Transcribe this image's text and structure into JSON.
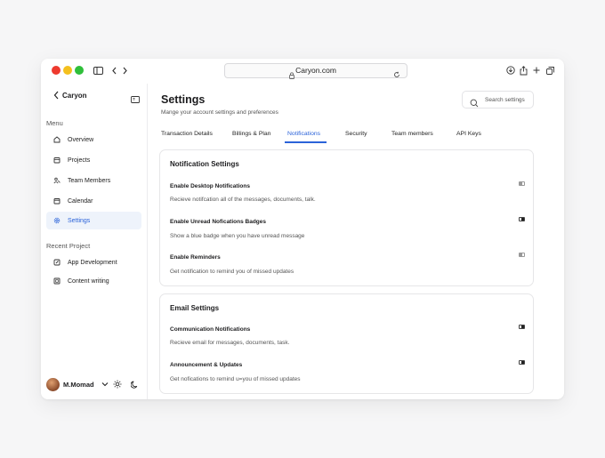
{
  "browser": {
    "url": "Caryon.com"
  },
  "sidebar": {
    "brand": "Caryon",
    "menu_label": "Menu",
    "items": [
      {
        "label": "Overview",
        "icon": "home-icon",
        "active": false
      },
      {
        "label": "Projects",
        "icon": "projects-icon",
        "active": false
      },
      {
        "label": "Team Members",
        "icon": "team-icon",
        "active": false
      },
      {
        "label": "Calendar",
        "icon": "calendar-icon",
        "active": false
      },
      {
        "label": "Settings",
        "icon": "gear-icon",
        "active": true
      }
    ],
    "recent_label": "Recent Project",
    "recent": [
      {
        "label": "App Development",
        "icon": "edit-icon"
      },
      {
        "label": "Content writing",
        "icon": "document-icon"
      }
    ],
    "user": {
      "name": "M.Momad"
    }
  },
  "header": {
    "title": "Settings",
    "subtitle": "Mange your account settings and preferences",
    "search_placeholder": "Search settings"
  },
  "tabs": [
    {
      "label": "Transaction Details",
      "active": false
    },
    {
      "label": "Billings & Plan",
      "active": false
    },
    {
      "label": "Notifications",
      "active": true
    },
    {
      "label": "Security",
      "active": false
    },
    {
      "label": "Team members",
      "active": false
    },
    {
      "label": "API Keys",
      "active": false
    }
  ],
  "notification_settings": {
    "title": "Notification Settings",
    "items": [
      {
        "title": "Enable Desktop Notifications",
        "desc": "Recieve notifcation all of the messages, documents, talk.",
        "enabled": false
      },
      {
        "title": "Enable Unread Nofications Badges",
        "desc": "Show a blue badge when you have unread message",
        "enabled": true
      },
      {
        "title": "Enable Reminders",
        "desc": "Get notification to remind you of missed updates",
        "enabled": false
      }
    ]
  },
  "email_settings": {
    "title": "Email Settings",
    "items": [
      {
        "title": "Communication Notifications",
        "desc": "Recieve email for messages, documents, task.",
        "enabled": true
      },
      {
        "title": "Announcement & Updates",
        "desc": "Get nofications to remind u=you of missed updates",
        "enabled": true
      }
    ]
  },
  "colors": {
    "accent": "#2b63d9",
    "active_bg": "#eef3fb"
  }
}
